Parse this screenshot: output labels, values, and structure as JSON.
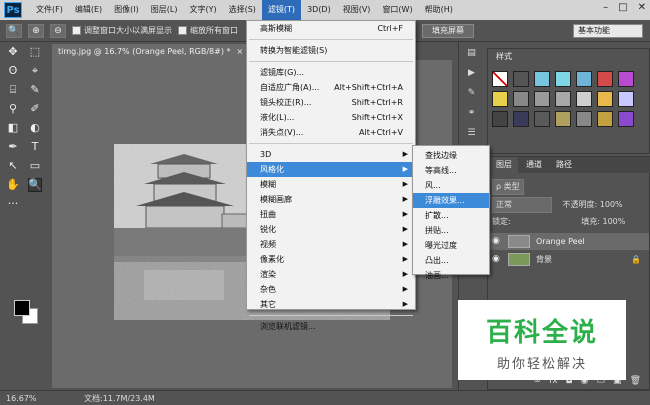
{
  "app": {
    "logo": "Ps"
  },
  "menubar": {
    "items": [
      "文件(F)",
      "编辑(E)",
      "图像(I)",
      "图层(L)",
      "文字(Y)",
      "选择(S)",
      "滤镜(T)",
      "3D(D)",
      "视图(V)",
      "窗口(W)",
      "帮助(H)"
    ],
    "active_index": 6,
    "window_controls": [
      "–",
      "□",
      "✕"
    ]
  },
  "options_bar": {
    "check1_label": "调整窗口大小以满屏显示",
    "check2_label": "缩放所有窗口",
    "fill_screen": "填充屏幕",
    "workspace": "基本功能"
  },
  "document": {
    "tab_title": "timg.jpg @ 16.7% (Orange Peel, RGB/8#) *",
    "zoom": "16.67%",
    "doc_info": "文档:11.7M/23.4M"
  },
  "filter_menu": {
    "items": [
      {
        "label": "高斯模糊",
        "shortcut": "Ctrl+F"
      },
      {
        "sep": true
      },
      {
        "label": "转换为智能滤镜(S)"
      },
      {
        "sep": true
      },
      {
        "label": "滤镜库(G)..."
      },
      {
        "label": "自适应广角(A)...",
        "shortcut": "Alt+Shift+Ctrl+A"
      },
      {
        "label": "镜头校正(R)...",
        "shortcut": "Shift+Ctrl+R"
      },
      {
        "label": "液化(L)...",
        "shortcut": "Shift+Ctrl+X"
      },
      {
        "label": "消失点(V)...",
        "shortcut": "Alt+Ctrl+V"
      },
      {
        "sep": true
      },
      {
        "label": "3D",
        "arrow": true
      },
      {
        "label": "风格化",
        "arrow": true,
        "highlight": true
      },
      {
        "label": "模糊",
        "arrow": true
      },
      {
        "label": "模糊画廊",
        "arrow": true
      },
      {
        "label": "扭曲",
        "arrow": true
      },
      {
        "label": "锐化",
        "arrow": true
      },
      {
        "label": "视频",
        "arrow": true
      },
      {
        "label": "像素化",
        "arrow": true
      },
      {
        "label": "渲染",
        "arrow": true
      },
      {
        "label": "杂色",
        "arrow": true
      },
      {
        "label": "其它",
        "arrow": true
      },
      {
        "sep": true
      },
      {
        "label": "浏览联机滤镜..."
      }
    ]
  },
  "stylize_submenu": {
    "items": [
      "查找边缘",
      "等高线...",
      "风...",
      "浮雕效果...",
      "扩散...",
      "拼贴...",
      "曝光过度",
      "凸出...",
      "油画..."
    ],
    "highlight_index": 3
  },
  "styles_panel": {
    "tab": "样式",
    "swatches": [
      "#ffffff",
      "#555555",
      "#77c6e0",
      "#7fd7e6",
      "#6fb3d8",
      "#d34a4a",
      "#b84bd1",
      "#e8d04a",
      "#888888",
      "#9a9a9a",
      "#a8a8a8",
      "#cfcfcf",
      "#e8b84a",
      "#c8c8ff",
      "#444444",
      "#3a3a5a",
      "#5a5a5a",
      "#b0a060",
      "#888888",
      "#c0a040",
      "#8a4ad0"
    ]
  },
  "layers_panel": {
    "tabs": [
      "图层",
      "通道",
      "路径"
    ],
    "kind_label": "ρ 类型",
    "blend_mode": "正常",
    "opacity_label": "不透明度: 100%",
    "lock_label": "锁定:",
    "fill_label": "填充: 100%",
    "layers": [
      {
        "name": "Orange Peel",
        "selected": true,
        "thumb_color": "#8a8a8a"
      },
      {
        "name": "背景",
        "selected": false,
        "thumb_color": "#7a9a5a",
        "locked": true
      }
    ],
    "footer_icons": [
      "∞",
      "fx",
      "◘",
      "◉",
      "▭",
      "▣",
      "🗑"
    ]
  },
  "toolbox": {
    "tools": [
      "✥",
      "⬚",
      "ʘ",
      "⌖",
      "⌸",
      "✎",
      "⚲",
      "✐",
      "◧",
      "◐",
      "✒",
      "T",
      "↖",
      "▭",
      "✋",
      "🔍",
      "···"
    ]
  },
  "watermark": {
    "title": "百科全说",
    "subtitle": "助你轻松解决"
  }
}
